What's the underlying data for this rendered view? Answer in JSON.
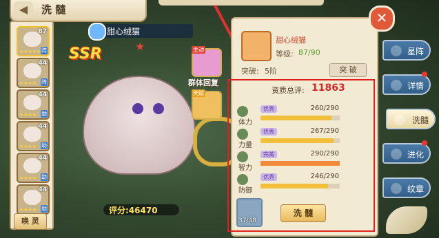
{
  "header": {
    "title": "洗 髓"
  },
  "hero_list": {
    "items": [
      {
        "level": "87",
        "stars": "★★★★★",
        "tag": "阵"
      },
      {
        "level": "44",
        "stars": "★★★★",
        "tag": "阵"
      },
      {
        "level": "44",
        "stars": "★★★★",
        "tag": "助"
      },
      {
        "level": "44",
        "stars": "★★★★",
        "tag": "助"
      },
      {
        "level": "44",
        "stars": "★★★★",
        "tag": "助"
      },
      {
        "level": "44",
        "stars": "★★★★",
        "tag": "助"
      }
    ],
    "summon_label": "唤 灵"
  },
  "character": {
    "name": "甜心绒猫",
    "rarity": "SSR",
    "score_label": "评分:46470"
  },
  "skills": [
    {
      "tag": "主动",
      "label": "群体回复"
    },
    {
      "tag": "天赋"
    }
  ],
  "panel": {
    "name": "甜心绒猫",
    "level_label": "等级:",
    "level_value": "87/90",
    "breakthrough_label": "突破:",
    "breakthrough_value": "5阶",
    "breakthrough_button": "突 破",
    "quality_label": "资质总评:",
    "quality_value": "11863",
    "stats": [
      {
        "name": "体力",
        "grade": "优秀",
        "value": "260/290",
        "fraction": 0.897,
        "color": "#f2c03a"
      },
      {
        "name": "力量",
        "grade": "优秀",
        "value": "267/290",
        "fraction": 0.921,
        "color": "#f2c03a"
      },
      {
        "name": "智力",
        "grade": "完美",
        "value": "290/290",
        "fraction": 1.0,
        "color": "#f08a3a"
      },
      {
        "name": "防御",
        "grade": "优秀",
        "value": "246/290",
        "fraction": 0.848,
        "color": "#f2c03a"
      }
    ],
    "item_count": "37/48",
    "refine_button": "洗 髓"
  },
  "tabs": [
    {
      "label": "星阵",
      "active": false
    },
    {
      "label": "详情",
      "active": false
    },
    {
      "label": "洗髓",
      "active": true
    },
    {
      "label": "进化",
      "active": false
    },
    {
      "label": "纹章",
      "active": false
    }
  ],
  "close_label": "✕"
}
